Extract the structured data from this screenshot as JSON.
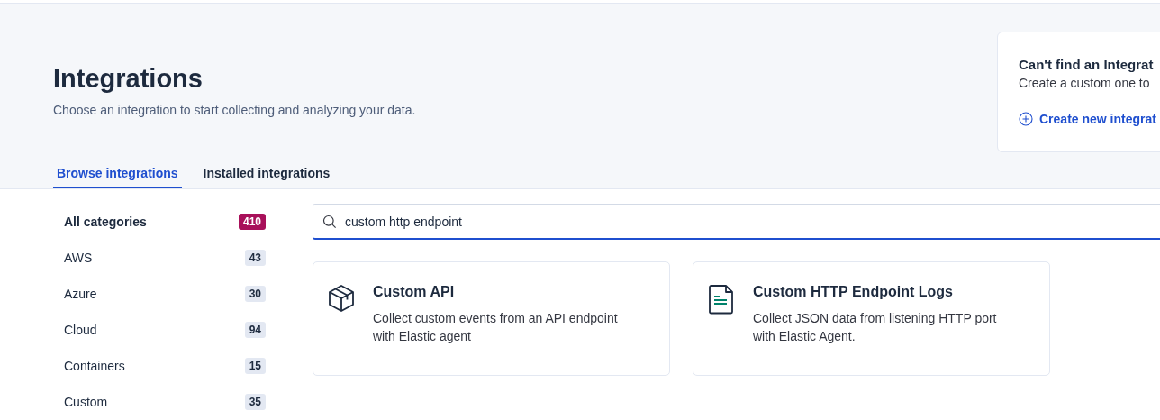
{
  "header": {
    "title": "Integrations",
    "subtitle": "Choose an integration to start collecting and analyzing your data."
  },
  "help_card": {
    "title": "Can't find an Integrat",
    "text": "Create a custom one to",
    "link": "Create new integrat"
  },
  "tabs": [
    {
      "label": "Browse integrations",
      "selected": true
    },
    {
      "label": "Installed integrations",
      "selected": false
    }
  ],
  "categories": [
    {
      "label": "All categories",
      "count": "410",
      "selected": true
    },
    {
      "label": "AWS",
      "count": "43",
      "selected": false
    },
    {
      "label": "Azure",
      "count": "30",
      "selected": false
    },
    {
      "label": "Cloud",
      "count": "94",
      "selected": false
    },
    {
      "label": "Containers",
      "count": "15",
      "selected": false
    },
    {
      "label": "Custom",
      "count": "35",
      "selected": false
    }
  ],
  "search": {
    "value": "custom http endpoint"
  },
  "cards": [
    {
      "kind": "box",
      "title": "Custom API",
      "description": "Collect custom events from an API endpoint with Elastic agent"
    },
    {
      "kind": "document",
      "title": "Custom HTTP Endpoint Logs",
      "description": "Collect JSON data from listening HTTP port with Elastic Agent."
    }
  ]
}
